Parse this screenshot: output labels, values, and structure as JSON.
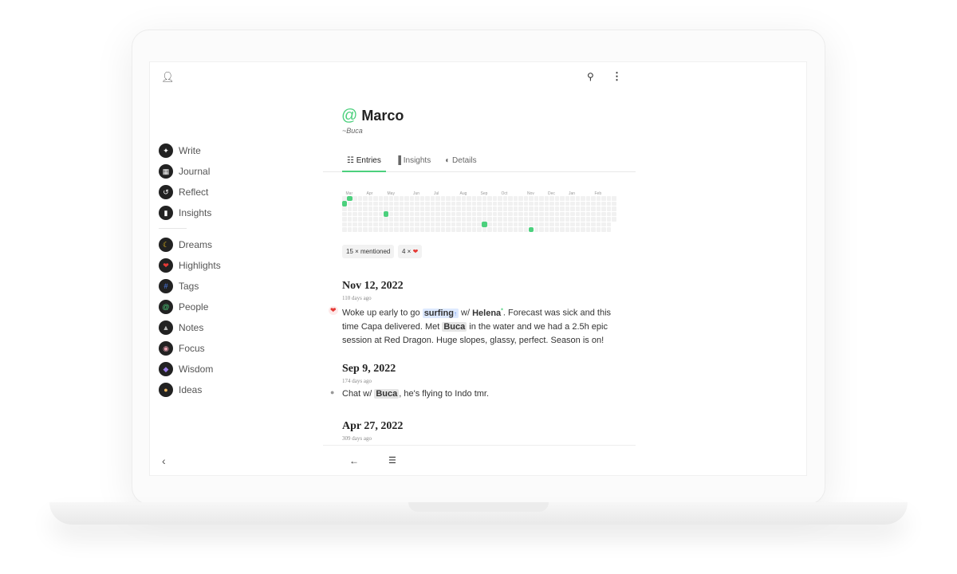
{
  "header": {
    "profile_icon": "person-icon",
    "search_icon": "search-icon",
    "menu_icon": "more-vertical-icon"
  },
  "sidebar": {
    "items": [
      {
        "label": "Write",
        "icon": "feather-icon",
        "color": "#ffffff"
      },
      {
        "label": "Journal",
        "icon": "journal-icon",
        "color": "#ffffff"
      },
      {
        "label": "Reflect",
        "icon": "history-icon",
        "color": "#ffffff"
      },
      {
        "label": "Insights",
        "icon": "bar-chart-icon",
        "color": "#ffffff"
      },
      {
        "label": "Dreams",
        "icon": "moon-icon",
        "color": "#f5c518"
      },
      {
        "label": "Highlights",
        "icon": "heart-icon",
        "color": "#e53935"
      },
      {
        "label": "Tags",
        "icon": "hash-icon",
        "color": "#4a7bea"
      },
      {
        "label": "People",
        "icon": "at-icon",
        "color": "#4cd07d"
      },
      {
        "label": "Notes",
        "icon": "pin-icon",
        "color": "#bbbbbb"
      },
      {
        "label": "Focus",
        "icon": "focus-icon",
        "color": "#e9a0b0"
      },
      {
        "label": "Wisdom",
        "icon": "gem-icon",
        "color": "#9b7bea"
      },
      {
        "label": "Ideas",
        "icon": "bulb-icon",
        "color": "#f0b860"
      }
    ],
    "collapse_icon": "chevron-left-icon"
  },
  "person": {
    "at": "@",
    "name": "Marco",
    "alias": "~Buca"
  },
  "tabs": [
    {
      "label": "Entries",
      "icon": "☷"
    },
    {
      "label": "Insights",
      "icon": "▐"
    },
    {
      "label": "Details",
      "icon": "◐"
    }
  ],
  "activity": {
    "months": [
      [
        "Mar",
        1
      ],
      [
        "Apr",
        5
      ],
      [
        "May",
        9
      ],
      [
        "Jun",
        14
      ],
      [
        "Jul",
        18
      ],
      [
        "Aug",
        23
      ],
      [
        "Sep",
        27
      ],
      [
        "Oct",
        31
      ],
      [
        "Nov",
        36
      ],
      [
        "Dec",
        40
      ],
      [
        "Jan",
        44
      ],
      [
        "Feb",
        49
      ]
    ],
    "weeks": 53,
    "last_week_days": 5,
    "active": [
      [
        1,
        0
      ],
      [
        0,
        1
      ],
      [
        8,
        3
      ],
      [
        27,
        5
      ],
      [
        36,
        6
      ]
    ],
    "color": "#4cd07d"
  },
  "stats": {
    "mentioned": "15 × mentioned",
    "hearts": "4 ×",
    "heart_icon": "heart-icon"
  },
  "entries": [
    {
      "date": "Nov 12, 2022",
      "ago": "110 days ago",
      "t1": "Woke up early to go ",
      "tag": "surfing",
      "tag_mark": "↑",
      "t2": " w/ ",
      "person": "Helena",
      "person_mark": "*",
      "t3": ". Forecast was sick and this time Capa delivered. Met ",
      "mention": "Buca",
      "t4": " in the water and we had a 2.5h epic session at Red Dragon. Huge slopes, glassy, perfect. Season is on!",
      "marker": "heart"
    },
    {
      "date": "Sep 9, 2022",
      "ago": "174 days ago",
      "t1": "Chat w/ ",
      "mention": "Buca",
      "t2": ", he's flying to Indo tmr.",
      "marker": "dot"
    },
    {
      "date": "Apr 27, 2022",
      "ago": "309 days ago"
    }
  ],
  "footer": {
    "back_icon": "arrow-left-icon",
    "list_icon": "list-icon"
  }
}
